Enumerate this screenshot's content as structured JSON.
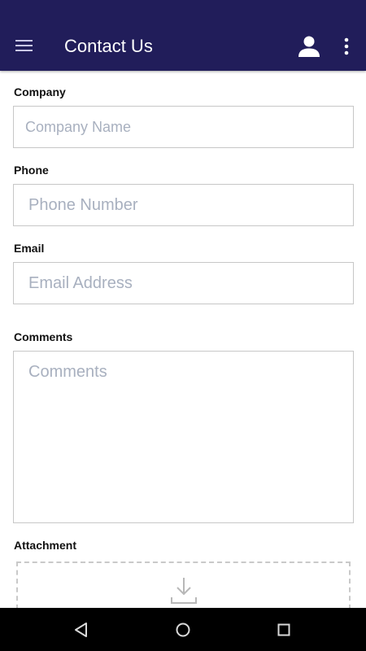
{
  "appbar": {
    "title": "Contact Us",
    "background": "#211d5a",
    "icons": [
      "menu-icon",
      "profile-icon",
      "more-vert-icon"
    ]
  },
  "form": {
    "company": {
      "label": "Company",
      "placeholder": "Company Name",
      "value": ""
    },
    "phone": {
      "label": "Phone",
      "placeholder": "Phone Number",
      "value": ""
    },
    "email": {
      "label": "Email",
      "placeholder": "Email Address",
      "value": ""
    },
    "comments": {
      "label": "Comments",
      "placeholder": "Comments",
      "value": ""
    },
    "attachment": {
      "label": "Attachment",
      "icon": "download-icon"
    }
  },
  "navbar": {
    "icons": [
      "back-icon",
      "home-icon",
      "recents-icon"
    ]
  }
}
